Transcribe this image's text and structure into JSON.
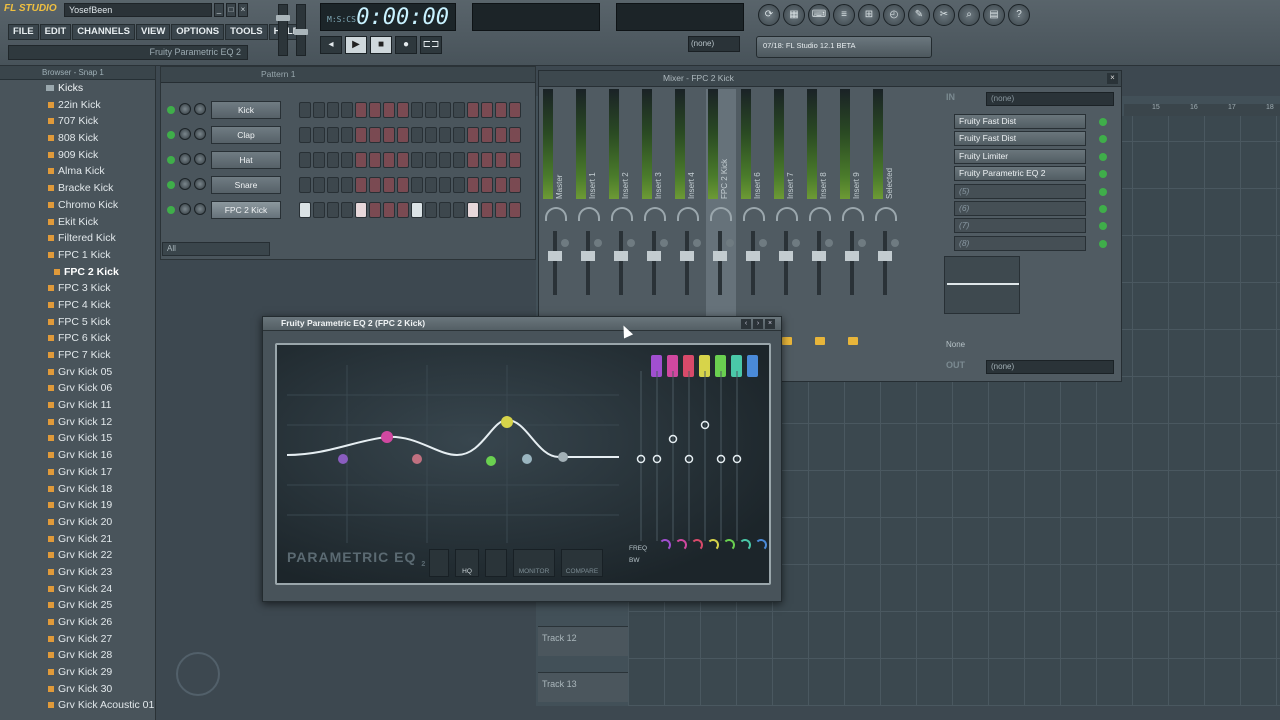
{
  "app": {
    "logo": "FL STUDIO",
    "user": "YosefBeen",
    "menu": [
      "FILE",
      "EDIT",
      "CHANNELS",
      "VIEW",
      "OPTIONS",
      "TOOLS",
      "HELP"
    ],
    "hint": "Fruity Parametric EQ 2",
    "time": "0:00:00",
    "time_small": "M:S:CS",
    "transport": [
      "◂",
      "▶",
      "■",
      "●",
      "⊏⊐"
    ],
    "pattern_select": "(none)",
    "news": "07/18: FL Studio 12.1 BETA",
    "tools": [
      "⟳",
      "▦",
      "⌨",
      "≡",
      "⊞",
      "◴",
      "✎",
      "✂",
      "⌕",
      "▤",
      "?"
    ]
  },
  "browser": {
    "title": "Browser - Snap 1",
    "folder": "Kicks",
    "items": [
      "22in Kick",
      "707 Kick",
      "808 Kick",
      "909 Kick",
      "Alma Kick",
      "Bracke Kick",
      "Chromo Kick",
      "Ekit Kick",
      "Filtered Kick",
      "FPC 1 Kick",
      "FPC 2 Kick",
      "FPC 3 Kick",
      "FPC 4 Kick",
      "FPC 5 Kick",
      "FPC 6 Kick",
      "FPC 7 Kick",
      "Grv Kick 05",
      "Grv Kick 06",
      "Grv Kick 11",
      "Grv Kick 12",
      "Grv Kick 15",
      "Grv Kick 16",
      "Grv Kick 17",
      "Grv Kick 18",
      "Grv Kick 19",
      "Grv Kick 20",
      "Grv Kick 21",
      "Grv Kick 22",
      "Grv Kick 23",
      "Grv Kick 24",
      "Grv Kick 25",
      "Grv Kick 26",
      "Grv Kick 27",
      "Grv Kick 28",
      "Grv Kick 29",
      "Grv Kick 30",
      "Grv Kick Acoustic 01"
    ],
    "selected": "FPC 2 Kick"
  },
  "sequencer": {
    "title": "Pattern 1",
    "channels": [
      {
        "name": "Kick",
        "steps": [
          0,
          0,
          0,
          0,
          0,
          0,
          0,
          0,
          0,
          0,
          0,
          0,
          0,
          0,
          0,
          0
        ]
      },
      {
        "name": "Clap",
        "steps": [
          0,
          0,
          0,
          0,
          0,
          0,
          0,
          0,
          0,
          0,
          0,
          0,
          0,
          0,
          0,
          0
        ]
      },
      {
        "name": "Hat",
        "steps": [
          0,
          0,
          0,
          0,
          0,
          0,
          0,
          0,
          0,
          0,
          0,
          0,
          0,
          0,
          0,
          0
        ]
      },
      {
        "name": "Snare",
        "steps": [
          0,
          0,
          0,
          0,
          0,
          0,
          0,
          0,
          0,
          0,
          0,
          0,
          0,
          0,
          0,
          0
        ]
      },
      {
        "name": "FPC 2 Kick",
        "steps": [
          2,
          0,
          0,
          0,
          1,
          0,
          0,
          0,
          2,
          0,
          0,
          0,
          1,
          0,
          0,
          0
        ]
      }
    ],
    "filter": "All"
  },
  "mixer": {
    "title": "Mixer - FPC 2 Kick",
    "strips": [
      "Master",
      "Insert 1",
      "Insert 2",
      "Insert 3",
      "Insert 4",
      "FPC 2 Kick",
      "Insert 6",
      "Insert 7",
      "Insert 8",
      "Insert 9",
      "Selected"
    ],
    "in_label": "IN",
    "in_value": "(none)",
    "out_label": "OUT",
    "out_value": "(none)",
    "fx": [
      "Fruity Fast Dist",
      "Fruity Fast Dist",
      "Fruity Limiter",
      "Fruity Parametric EQ 2",
      "(5)",
      "(6)",
      "(7)",
      "(8)"
    ],
    "none_label": "None"
  },
  "playlist": {
    "ruler": [
      "15",
      "16",
      "17",
      "18"
    ],
    "tracks": [
      "Track 12",
      "Track 13"
    ]
  },
  "plugin": {
    "title": "Fruity Parametric EQ 2 (FPC 2 Kick)",
    "logo": "PARAMETRIC EQ",
    "logo_sub": "2",
    "controls": [
      "HQ",
      "MONITOR",
      "COMPARE"
    ],
    "labels": [
      "FREQ",
      "BW"
    ],
    "band_colors": [
      "#a14fd0",
      "#d048a0",
      "#d84a6a",
      "#d7d44a",
      "#6ad050",
      "#4ac8a8",
      "#4a8ad8"
    ]
  }
}
